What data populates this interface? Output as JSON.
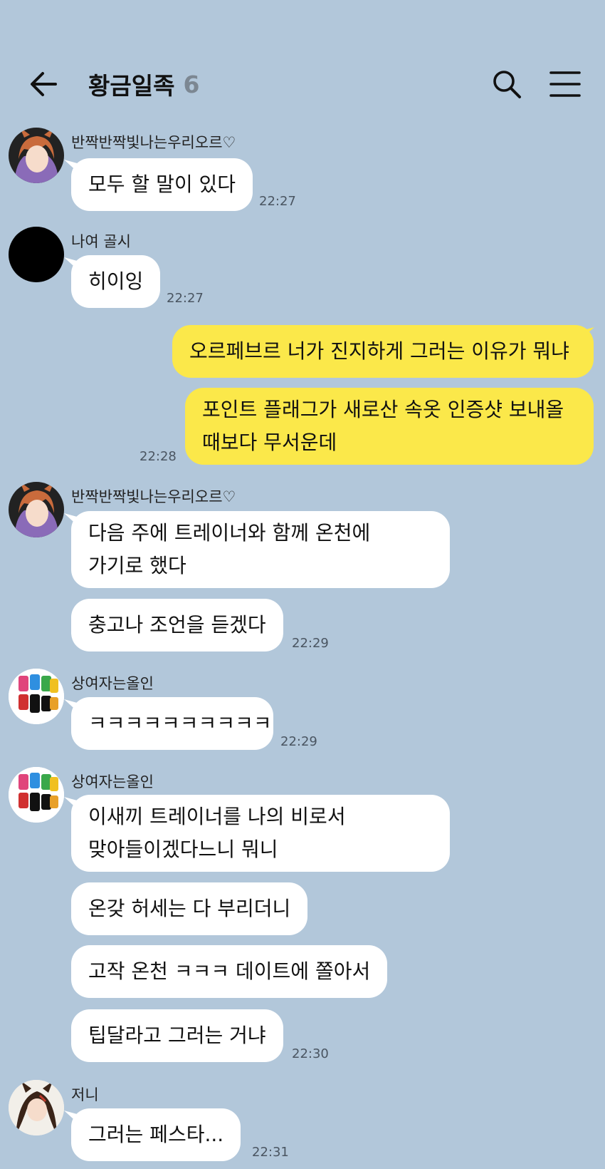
{
  "header": {
    "title": "황금일족",
    "member_count": "6"
  },
  "colors": {
    "background": "#b2c7da",
    "my_bubble": "#fbe84a",
    "other_bubble": "#ffffff"
  },
  "icons": {
    "back": "arrow-left-icon",
    "search": "search-icon",
    "menu": "hamburger-menu-icon"
  },
  "messages": [
    {
      "sender": "반짝반짝빛나는우리오르♡",
      "texts": [
        "모두 할 말이 있다"
      ],
      "time": "22:27"
    },
    {
      "sender": "나여 골시",
      "texts": [
        "히이잉"
      ],
      "time": "22:27"
    },
    {
      "texts": [
        "오르페브르 너가 진지하게 그러는 이유가 뭐냐"
      ]
    },
    {
      "texts": [
        "포인트 플래그가 새로산 속옷 인증샷 보내올",
        "때보다 무서운데"
      ],
      "time": "22:28"
    },
    {
      "sender": "반짝반짝빛나는우리오르♡",
      "texts": [
        "다음 주에 트레이너와 함께 온천에",
        "가기로 했다"
      ]
    },
    {
      "texts": [
        "충고나 조언을 듣겠다"
      ],
      "time": "22:29"
    },
    {
      "sender": "상여자는올인",
      "texts": [
        "ㅋㅋㅋㅋㅋㅋㅋㅋㅋㅋ"
      ],
      "time": "22:29"
    },
    {
      "sender": "상여자는올인",
      "texts": [
        "이새끼 트레이너를 나의 비로서",
        "맞아들이겠다느니 뭐니"
      ]
    },
    {
      "texts": [
        "온갖 허세는 다 부리더니"
      ]
    },
    {
      "texts": [
        "고작 온천 ㅋㅋㅋ 데이트에 쫄아서"
      ]
    },
    {
      "texts": [
        "팁달라고 그러는 거냐"
      ],
      "time": "22:30"
    },
    {
      "sender": "저니",
      "texts": [
        "그러는 페스타..."
      ],
      "time": "22:31"
    }
  ]
}
